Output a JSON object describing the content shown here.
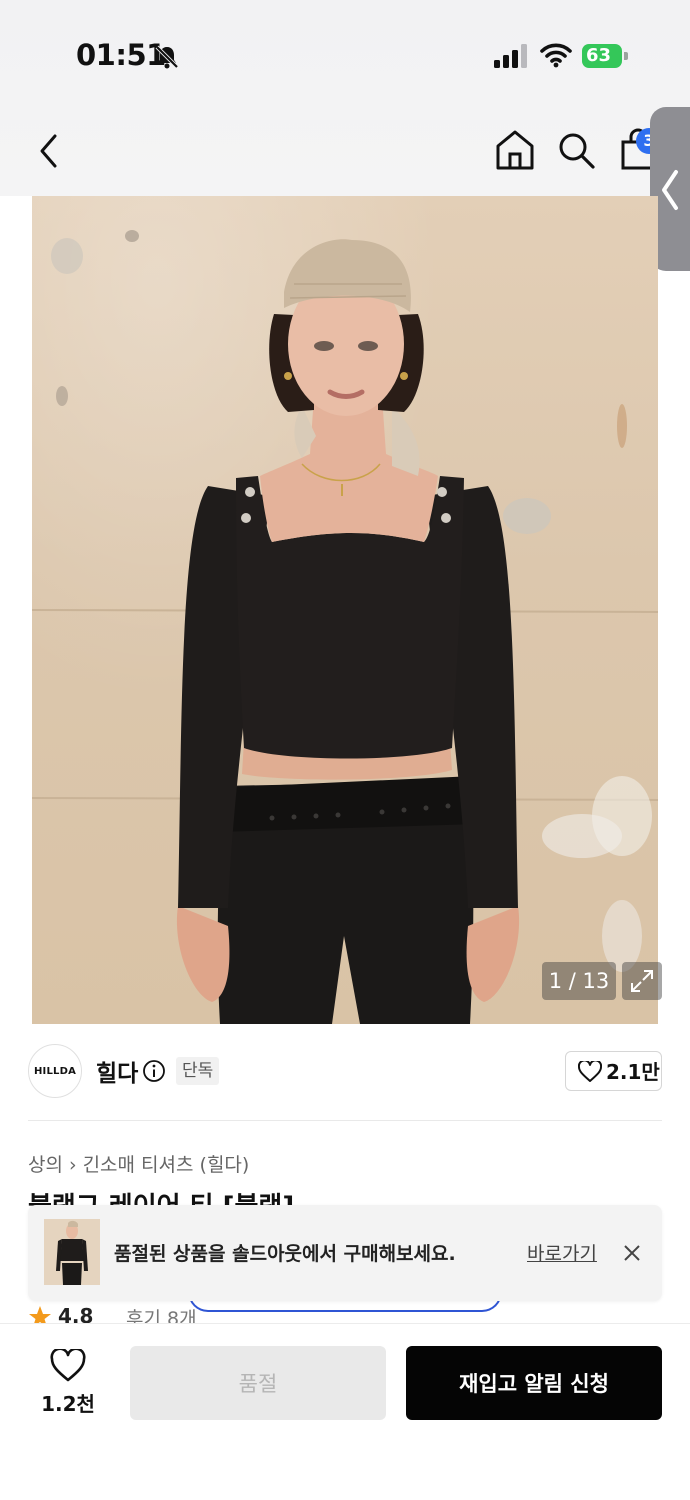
{
  "status_bar": {
    "time": "01:51",
    "battery": "63",
    "icons": [
      "bell-slash-icon",
      "signal-icon",
      "wifi-icon",
      "battery-charging-icon"
    ]
  },
  "nav": {
    "cart_badge": "3",
    "icons": [
      "chevron-left-icon",
      "home-icon",
      "search-icon",
      "cart-icon",
      "side-panel-chevron-icon"
    ]
  },
  "gallery": {
    "counter": "1 / 13"
  },
  "brand": {
    "logo_text": "HILLDA",
    "name": "힐다",
    "tag": "단독",
    "likes": "2.1만"
  },
  "breadcrumb": {
    "category": "상의",
    "subcategory": "긴소매 티셔츠 (힐다)"
  },
  "product": {
    "title_partial": "블랙그 레이어 티 [블랙]"
  },
  "toast": {
    "message": "품절된 상품을 솔드아웃에서 구매해보세요.",
    "link": "바로가기"
  },
  "rating": {
    "value": "4.8",
    "reviews": "후기 8개"
  },
  "bottom_bar": {
    "wish_count": "1.2천",
    "soldout_label": "품절",
    "restock_label": "재입고 알림 신청"
  },
  "colors": {
    "accent_blue": "#2f6ff0",
    "battery_green": "#34c759",
    "star_orange": "#f39a1c",
    "primary_black": "#050505"
  }
}
